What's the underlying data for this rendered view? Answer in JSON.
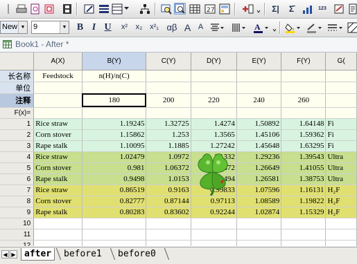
{
  "toolbar": {
    "style_name": "New",
    "font_size": "9",
    "bold": "B",
    "italic": "I",
    "underline": "U",
    "superscript": "x²",
    "subscript": "x₂",
    "supsub": "x²₁",
    "greek": "αβ",
    "grow_font": "A",
    "shrink_font": "A",
    "sigma_col": "Σ|",
    "sigma_row": "Σ̄",
    "sort_label": "123"
  },
  "window": {
    "title": "Book1 - After *"
  },
  "columns": [
    {
      "id": "A",
      "label": "A(X)"
    },
    {
      "id": "B",
      "label": "B(Y)"
    },
    {
      "id": "C",
      "label": "C(Y)"
    },
    {
      "id": "D",
      "label": "D(Y)"
    },
    {
      "id": "E",
      "label": "E(Y)"
    },
    {
      "id": "F",
      "label": "F(Y)"
    },
    {
      "id": "G",
      "label": "G("
    }
  ],
  "meta_rows": {
    "long_name_label": "长名称",
    "units_label": "单位",
    "comments_label": "注释",
    "fx_label": "F(x)=",
    "long_name": [
      "Feedstock",
      "n(H)/n(C)",
      "",
      "",
      "",
      "",
      ""
    ],
    "units": [
      "",
      "",
      "",
      "",
      "",
      "",
      ""
    ],
    "comments": [
      "",
      "180",
      "200",
      "220",
      "240",
      "260",
      ""
    ]
  },
  "rows": [
    {
      "num": "1",
      "group": "g1",
      "cells": [
        "Rice straw",
        "1.19245",
        "1.32725",
        "1.4274",
        "1.50892",
        "1.64148",
        "Fi"
      ]
    },
    {
      "num": "2",
      "group": "g1",
      "cells": [
        "Corn stover",
        "1.15862",
        "1.253",
        "1.3565",
        "1.45106",
        "1.59362",
        "Fi"
      ]
    },
    {
      "num": "3",
      "group": "g1",
      "cells": [
        "Rape stalk",
        "1.10095",
        "1.1885",
        "1.27242",
        "1.45648",
        "1.63295",
        "Fi"
      ]
    },
    {
      "num": "4",
      "group": "g2",
      "cells": [
        "Rice straw",
        "1.02479",
        "1.0972",
        "1.1332",
        "1.29236",
        "1.39543",
        "Ultra"
      ]
    },
    {
      "num": "5",
      "group": "g2",
      "cells": [
        "Corn stover",
        "0.981",
        "1.06372",
        "1.0872",
        "1.26649",
        "1.41055",
        "Ultra"
      ]
    },
    {
      "num": "6",
      "group": "g2",
      "cells": [
        "Rape stalk",
        "0.9498",
        "1.0153",
        "1.0494",
        "1.26581",
        "1.38753",
        "Ultra"
      ]
    },
    {
      "num": "7",
      "group": "g3",
      "cells": [
        "Rice straw",
        "0.86519",
        "0.9163",
        "0.99833",
        "1.07596",
        "1.16131",
        "H₂F"
      ]
    },
    {
      "num": "8",
      "group": "g3",
      "cells": [
        "Corn stover",
        "0.82777",
        "0.87144",
        "0.97113",
        "1.08589",
        "1.19822",
        "H₂F"
      ]
    },
    {
      "num": "9",
      "group": "g3",
      "cells": [
        "Rape stalk",
        "0.80283",
        "0.83602",
        "0.92244",
        "1.02874",
        "1.15329",
        "H₂F"
      ]
    },
    {
      "num": "10",
      "group": "empty",
      "cells": [
        "",
        "",
        "",
        "",
        "",
        "",
        ""
      ]
    },
    {
      "num": "11",
      "group": "empty",
      "cells": [
        "",
        "",
        "",
        "",
        "",
        "",
        ""
      ]
    },
    {
      "num": "12",
      "group": "empty",
      "cells": [
        "",
        "",
        "",
        "",
        "",
        "",
        ""
      ]
    },
    {
      "num": "13",
      "group": "empty",
      "cells": [
        "",
        "",
        "",
        "",
        "",
        "",
        ""
      ]
    }
  ],
  "sheets": [
    {
      "label": "after",
      "active": true
    },
    {
      "label": "before1",
      "active": false
    },
    {
      "label": "before0",
      "active": false
    }
  ],
  "icons": {
    "overlay": "clover-icon"
  }
}
